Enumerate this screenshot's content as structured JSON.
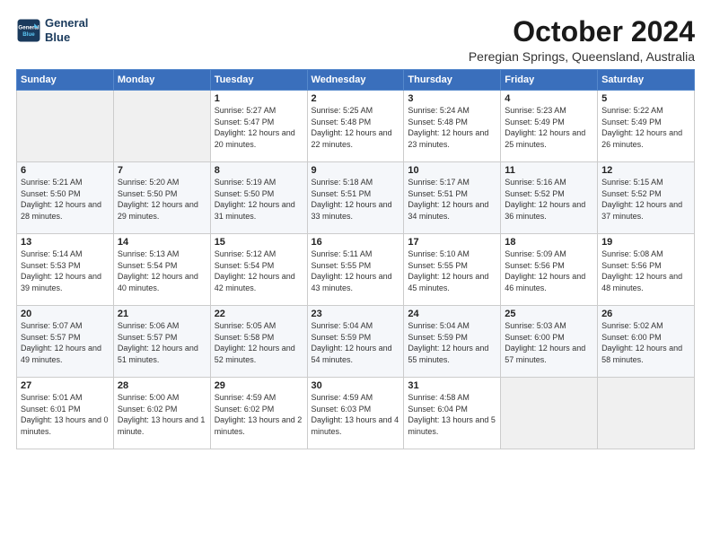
{
  "logo": {
    "line1": "General",
    "line2": "Blue"
  },
  "title": "October 2024",
  "location": "Peregian Springs, Queensland, Australia",
  "weekdays": [
    "Sunday",
    "Monday",
    "Tuesday",
    "Wednesday",
    "Thursday",
    "Friday",
    "Saturday"
  ],
  "weeks": [
    [
      {
        "day": "",
        "sunrise": "",
        "sunset": "",
        "daylight": ""
      },
      {
        "day": "",
        "sunrise": "",
        "sunset": "",
        "daylight": ""
      },
      {
        "day": "1",
        "sunrise": "Sunrise: 5:27 AM",
        "sunset": "Sunset: 5:47 PM",
        "daylight": "Daylight: 12 hours and 20 minutes."
      },
      {
        "day": "2",
        "sunrise": "Sunrise: 5:25 AM",
        "sunset": "Sunset: 5:48 PM",
        "daylight": "Daylight: 12 hours and 22 minutes."
      },
      {
        "day": "3",
        "sunrise": "Sunrise: 5:24 AM",
        "sunset": "Sunset: 5:48 PM",
        "daylight": "Daylight: 12 hours and 23 minutes."
      },
      {
        "day": "4",
        "sunrise": "Sunrise: 5:23 AM",
        "sunset": "Sunset: 5:49 PM",
        "daylight": "Daylight: 12 hours and 25 minutes."
      },
      {
        "day": "5",
        "sunrise": "Sunrise: 5:22 AM",
        "sunset": "Sunset: 5:49 PM",
        "daylight": "Daylight: 12 hours and 26 minutes."
      }
    ],
    [
      {
        "day": "6",
        "sunrise": "Sunrise: 5:21 AM",
        "sunset": "Sunset: 5:50 PM",
        "daylight": "Daylight: 12 hours and 28 minutes."
      },
      {
        "day": "7",
        "sunrise": "Sunrise: 5:20 AM",
        "sunset": "Sunset: 5:50 PM",
        "daylight": "Daylight: 12 hours and 29 minutes."
      },
      {
        "day": "8",
        "sunrise": "Sunrise: 5:19 AM",
        "sunset": "Sunset: 5:50 PM",
        "daylight": "Daylight: 12 hours and 31 minutes."
      },
      {
        "day": "9",
        "sunrise": "Sunrise: 5:18 AM",
        "sunset": "Sunset: 5:51 PM",
        "daylight": "Daylight: 12 hours and 33 minutes."
      },
      {
        "day": "10",
        "sunrise": "Sunrise: 5:17 AM",
        "sunset": "Sunset: 5:51 PM",
        "daylight": "Daylight: 12 hours and 34 minutes."
      },
      {
        "day": "11",
        "sunrise": "Sunrise: 5:16 AM",
        "sunset": "Sunset: 5:52 PM",
        "daylight": "Daylight: 12 hours and 36 minutes."
      },
      {
        "day": "12",
        "sunrise": "Sunrise: 5:15 AM",
        "sunset": "Sunset: 5:52 PM",
        "daylight": "Daylight: 12 hours and 37 minutes."
      }
    ],
    [
      {
        "day": "13",
        "sunrise": "Sunrise: 5:14 AM",
        "sunset": "Sunset: 5:53 PM",
        "daylight": "Daylight: 12 hours and 39 minutes."
      },
      {
        "day": "14",
        "sunrise": "Sunrise: 5:13 AM",
        "sunset": "Sunset: 5:54 PM",
        "daylight": "Daylight: 12 hours and 40 minutes."
      },
      {
        "day": "15",
        "sunrise": "Sunrise: 5:12 AM",
        "sunset": "Sunset: 5:54 PM",
        "daylight": "Daylight: 12 hours and 42 minutes."
      },
      {
        "day": "16",
        "sunrise": "Sunrise: 5:11 AM",
        "sunset": "Sunset: 5:55 PM",
        "daylight": "Daylight: 12 hours and 43 minutes."
      },
      {
        "day": "17",
        "sunrise": "Sunrise: 5:10 AM",
        "sunset": "Sunset: 5:55 PM",
        "daylight": "Daylight: 12 hours and 45 minutes."
      },
      {
        "day": "18",
        "sunrise": "Sunrise: 5:09 AM",
        "sunset": "Sunset: 5:56 PM",
        "daylight": "Daylight: 12 hours and 46 minutes."
      },
      {
        "day": "19",
        "sunrise": "Sunrise: 5:08 AM",
        "sunset": "Sunset: 5:56 PM",
        "daylight": "Daylight: 12 hours and 48 minutes."
      }
    ],
    [
      {
        "day": "20",
        "sunrise": "Sunrise: 5:07 AM",
        "sunset": "Sunset: 5:57 PM",
        "daylight": "Daylight: 12 hours and 49 minutes."
      },
      {
        "day": "21",
        "sunrise": "Sunrise: 5:06 AM",
        "sunset": "Sunset: 5:57 PM",
        "daylight": "Daylight: 12 hours and 51 minutes."
      },
      {
        "day": "22",
        "sunrise": "Sunrise: 5:05 AM",
        "sunset": "Sunset: 5:58 PM",
        "daylight": "Daylight: 12 hours and 52 minutes."
      },
      {
        "day": "23",
        "sunrise": "Sunrise: 5:04 AM",
        "sunset": "Sunset: 5:59 PM",
        "daylight": "Daylight: 12 hours and 54 minutes."
      },
      {
        "day": "24",
        "sunrise": "Sunrise: 5:04 AM",
        "sunset": "Sunset: 5:59 PM",
        "daylight": "Daylight: 12 hours and 55 minutes."
      },
      {
        "day": "25",
        "sunrise": "Sunrise: 5:03 AM",
        "sunset": "Sunset: 6:00 PM",
        "daylight": "Daylight: 12 hours and 57 minutes."
      },
      {
        "day": "26",
        "sunrise": "Sunrise: 5:02 AM",
        "sunset": "Sunset: 6:00 PM",
        "daylight": "Daylight: 12 hours and 58 minutes."
      }
    ],
    [
      {
        "day": "27",
        "sunrise": "Sunrise: 5:01 AM",
        "sunset": "Sunset: 6:01 PM",
        "daylight": "Daylight: 13 hours and 0 minutes."
      },
      {
        "day": "28",
        "sunrise": "Sunrise: 5:00 AM",
        "sunset": "Sunset: 6:02 PM",
        "daylight": "Daylight: 13 hours and 1 minute."
      },
      {
        "day": "29",
        "sunrise": "Sunrise: 4:59 AM",
        "sunset": "Sunset: 6:02 PM",
        "daylight": "Daylight: 13 hours and 2 minutes."
      },
      {
        "day": "30",
        "sunrise": "Sunrise: 4:59 AM",
        "sunset": "Sunset: 6:03 PM",
        "daylight": "Daylight: 13 hours and 4 minutes."
      },
      {
        "day": "31",
        "sunrise": "Sunrise: 4:58 AM",
        "sunset": "Sunset: 6:04 PM",
        "daylight": "Daylight: 13 hours and 5 minutes."
      },
      {
        "day": "",
        "sunrise": "",
        "sunset": "",
        "daylight": ""
      },
      {
        "day": "",
        "sunrise": "",
        "sunset": "",
        "daylight": ""
      }
    ]
  ]
}
